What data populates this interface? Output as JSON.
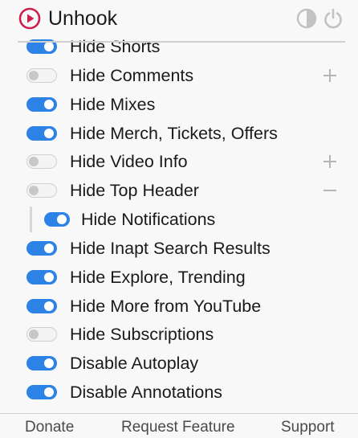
{
  "header": {
    "title": "Unhook",
    "logo_icon": "play-circle-icon",
    "accent_color": "#cc1f4b",
    "actions": [
      {
        "icon": "contrast-icon",
        "label": "Toggle theme"
      },
      {
        "icon": "power-icon",
        "label": "Power"
      }
    ]
  },
  "options": [
    {
      "label": "Hide Shorts",
      "enabled": true
    },
    {
      "label": "Hide Comments",
      "enabled": false,
      "expander": "plus"
    },
    {
      "label": "Hide Mixes",
      "enabled": true
    },
    {
      "label": "Hide Merch, Tickets, Offers",
      "enabled": true
    },
    {
      "label": "Hide Video Info",
      "enabled": false,
      "expander": "plus"
    },
    {
      "label": "Hide Top Header",
      "enabled": false,
      "expander": "minus"
    },
    {
      "label": "Hide Notifications",
      "enabled": true,
      "child": true
    },
    {
      "label": "Hide Inapt Search Results",
      "enabled": true
    },
    {
      "label": "Hide Explore, Trending",
      "enabled": true
    },
    {
      "label": "Hide More from YouTube",
      "enabled": true
    },
    {
      "label": "Hide Subscriptions",
      "enabled": false
    },
    {
      "label": "Disable Autoplay",
      "enabled": true
    },
    {
      "label": "Disable Annotations",
      "enabled": true
    }
  ],
  "footer": {
    "donate": "Donate",
    "request_feature": "Request Feature",
    "support": "Support"
  },
  "colors": {
    "toggle_on": "#2d82e6",
    "toggle_off": "#f4f4f4",
    "background": "#f8f8f8"
  }
}
